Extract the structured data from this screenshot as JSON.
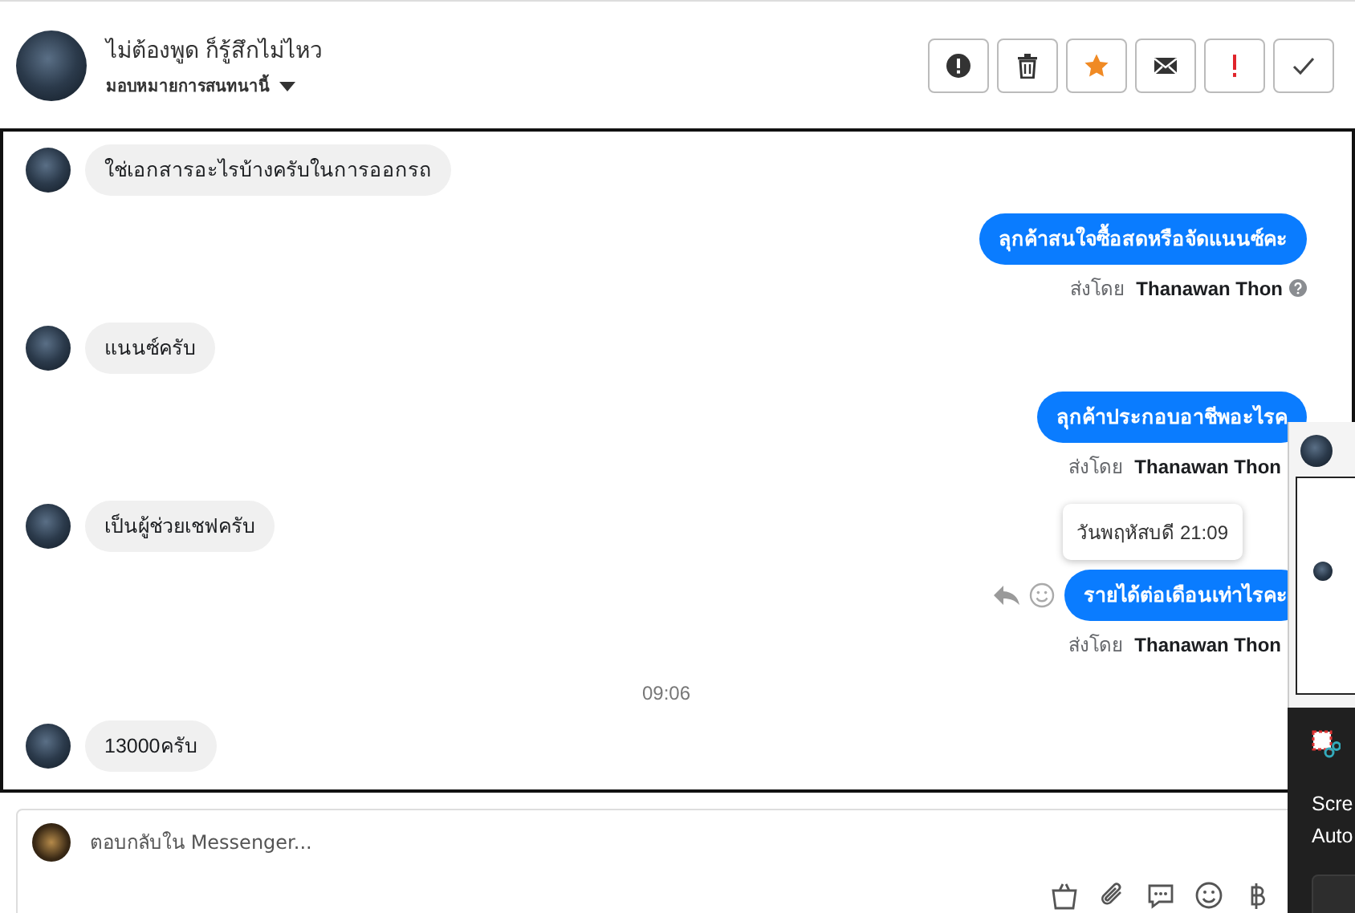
{
  "header": {
    "title": "ไม่ต้องพูด ก็รู้สึกไม่ไหว",
    "subtitle": "มอบหมายการสนทนานี้",
    "buttons": [
      {
        "kind": "alert"
      },
      {
        "kind": "trash"
      },
      {
        "kind": "star"
      },
      {
        "kind": "mail"
      },
      {
        "kind": "exclaim"
      },
      {
        "kind": "check"
      }
    ]
  },
  "messages": [
    {
      "kind": "incoming",
      "text": "ใช่เอกสารอะไรบ้างครับในการออกรถ"
    },
    {
      "kind": "outgoing",
      "text": "ลุกค้าสนใจซื้อสดหรือจัดแนนซ์คะ",
      "sender_prefix": "ส่งโดย",
      "sender": "Thanawan Thon",
      "help": true
    },
    {
      "kind": "incoming",
      "text": "แนนซ์ครับ"
    },
    {
      "kind": "outgoing",
      "text": "ลุกค้าประกอบอาชีพอะไรค",
      "sender_prefix": "ส่งโดย",
      "sender": "Thanawan Thon",
      "help": false
    },
    {
      "kind": "incoming",
      "text": "เป็นผู้ช่วยเชฟครับ",
      "tooltip": "วันพฤหัสบดี 21:09"
    },
    {
      "kind": "outgoing",
      "text": "รายได้ต่อเดือนเท่าไรคะ",
      "sender_prefix": "ส่งโดย",
      "sender": "Thanawan Thon",
      "help": false,
      "actions": true
    },
    {
      "kind": "time",
      "text": "09:06"
    },
    {
      "kind": "incoming",
      "text": "13000ครับ"
    }
  ],
  "composer": {
    "placeholder": "ตอบกลับใน Messenger...",
    "tools": [
      {
        "kind": "bag"
      },
      {
        "kind": "clip"
      },
      {
        "kind": "chat"
      },
      {
        "kind": "smile"
      },
      {
        "kind": "baht"
      }
    ]
  },
  "notification": {
    "lines": [
      "Scre",
      "Auto"
    ]
  }
}
